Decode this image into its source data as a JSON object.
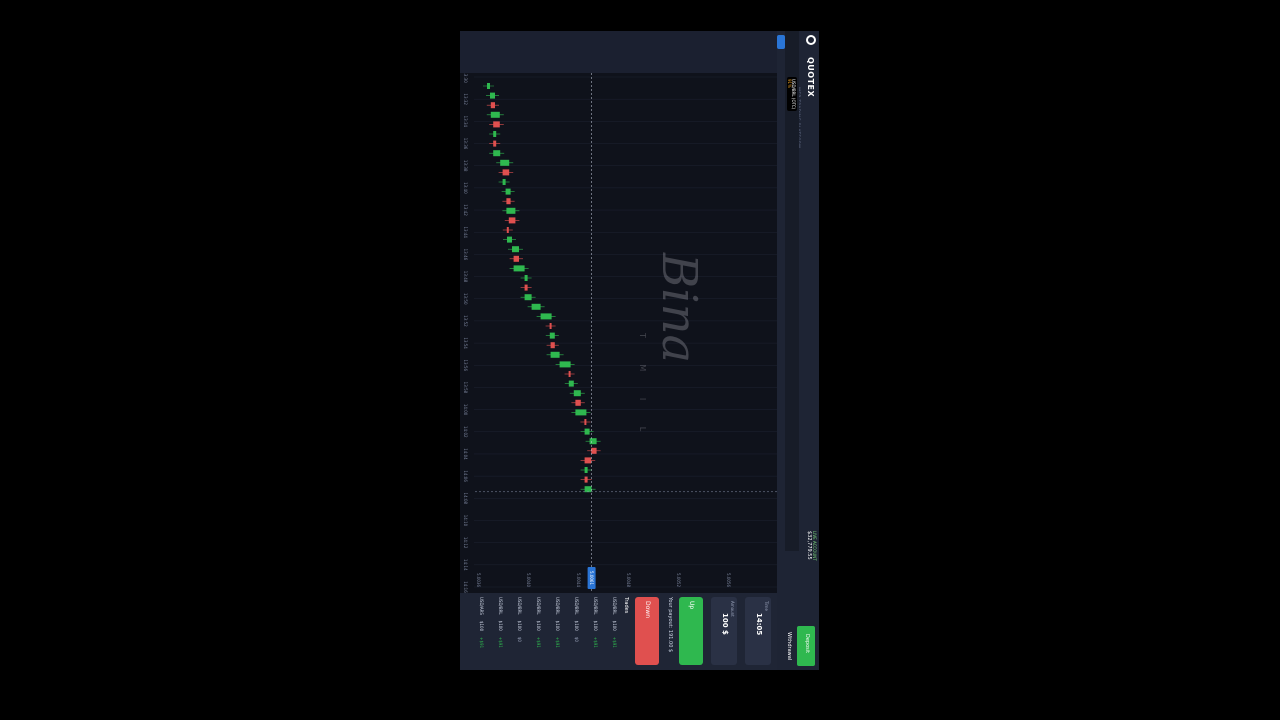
{
  "app": {
    "brand": "QUOTEX",
    "brand_sub": "WEB TRADING PLATFORM",
    "balance_label": "LIVE ACCOUNT",
    "balance_value": "$32,779.55",
    "deposit_label": "Deposit",
    "withdrawal_label": "Withdrawal"
  },
  "asset": {
    "name": "USD/BRL (OTC)",
    "payout": "91%"
  },
  "chart": {
    "time_labels": [
      "13:30",
      "13:32",
      "13:34",
      "13:36",
      "13:38",
      "13:40",
      "13:42",
      "13:44",
      "13:46",
      "13:48",
      "13:50",
      "13:52",
      "13:54",
      "13:56",
      "13:58",
      "14:00",
      "14:02",
      "14:04",
      "14:06",
      "14:08",
      "14:10",
      "14:12",
      "14:14",
      "14:16"
    ],
    "price_labels": [
      "5.0036",
      "5.0040",
      "5.0044",
      "5.0048",
      "5.0052",
      "5.0056"
    ],
    "current_price": "5.0061",
    "watermark": "Bina",
    "watermark_sub": "T M I L"
  },
  "panel": {
    "time_label": "Time",
    "time_value": "14:05",
    "amount_label": "Amount",
    "amount_value": "100 $",
    "up_label": "Up",
    "down_label": "Down",
    "payout_label": "Your payout: 191.00 $",
    "trades_label": "Trades",
    "trades": [
      {
        "asset": "USD/BRL",
        "amount": "$100",
        "result": "+$91"
      },
      {
        "asset": "USD/BRL",
        "amount": "$100",
        "result": "+$91"
      },
      {
        "asset": "USD/BRL",
        "amount": "$100",
        "result": "$0"
      },
      {
        "asset": "USD/BRL",
        "amount": "$100",
        "result": "+$91"
      },
      {
        "asset": "USD/BRL",
        "amount": "$100",
        "result": "+$91"
      },
      {
        "asset": "USD/BRL",
        "amount": "$100",
        "result": "$0"
      },
      {
        "asset": "USD/BRL",
        "amount": "$100",
        "result": "+$91"
      },
      {
        "asset": "USD/ARS",
        "amount": "$100",
        "result": "+$91"
      }
    ]
  },
  "colors": {
    "up": "#2fb84f",
    "down": "#e0504f",
    "accent": "#2a75d6"
  }
}
